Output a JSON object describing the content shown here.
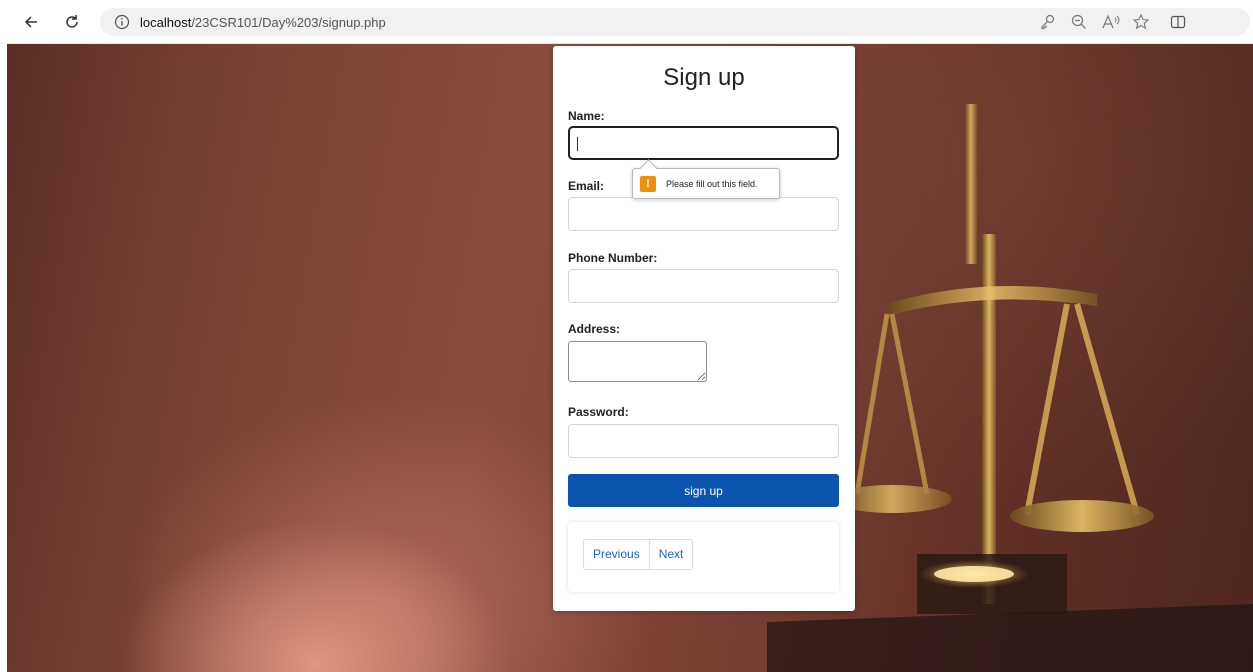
{
  "browser": {
    "url_host": "localhost",
    "url_path": "/23CSR101/Day%203/signup.php",
    "icons": {
      "back": "back-arrow-icon",
      "refresh": "refresh-icon",
      "info": "info-icon",
      "key": "key-icon",
      "zoom": "zoom-out-icon",
      "read_aloud": "read-aloud-icon",
      "favorite": "star-icon",
      "split": "split-screen-icon"
    }
  },
  "form": {
    "title": "Sign up",
    "name_label": "Name:",
    "name_value": "",
    "email_label": "Email:",
    "email_value": "",
    "phone_label": "Phone Number:",
    "phone_value": "",
    "address_label": "Address:",
    "address_value": "",
    "password_label": "Password:",
    "password_value": "",
    "submit_label": "sign up"
  },
  "pagination": {
    "previous": "Previous",
    "next": "Next"
  },
  "validation": {
    "icon": "!",
    "message": "Please fill out this field."
  },
  "colors": {
    "primary_button": "#0b55b0",
    "link": "#1a63c6",
    "warning": "#f0900a"
  }
}
